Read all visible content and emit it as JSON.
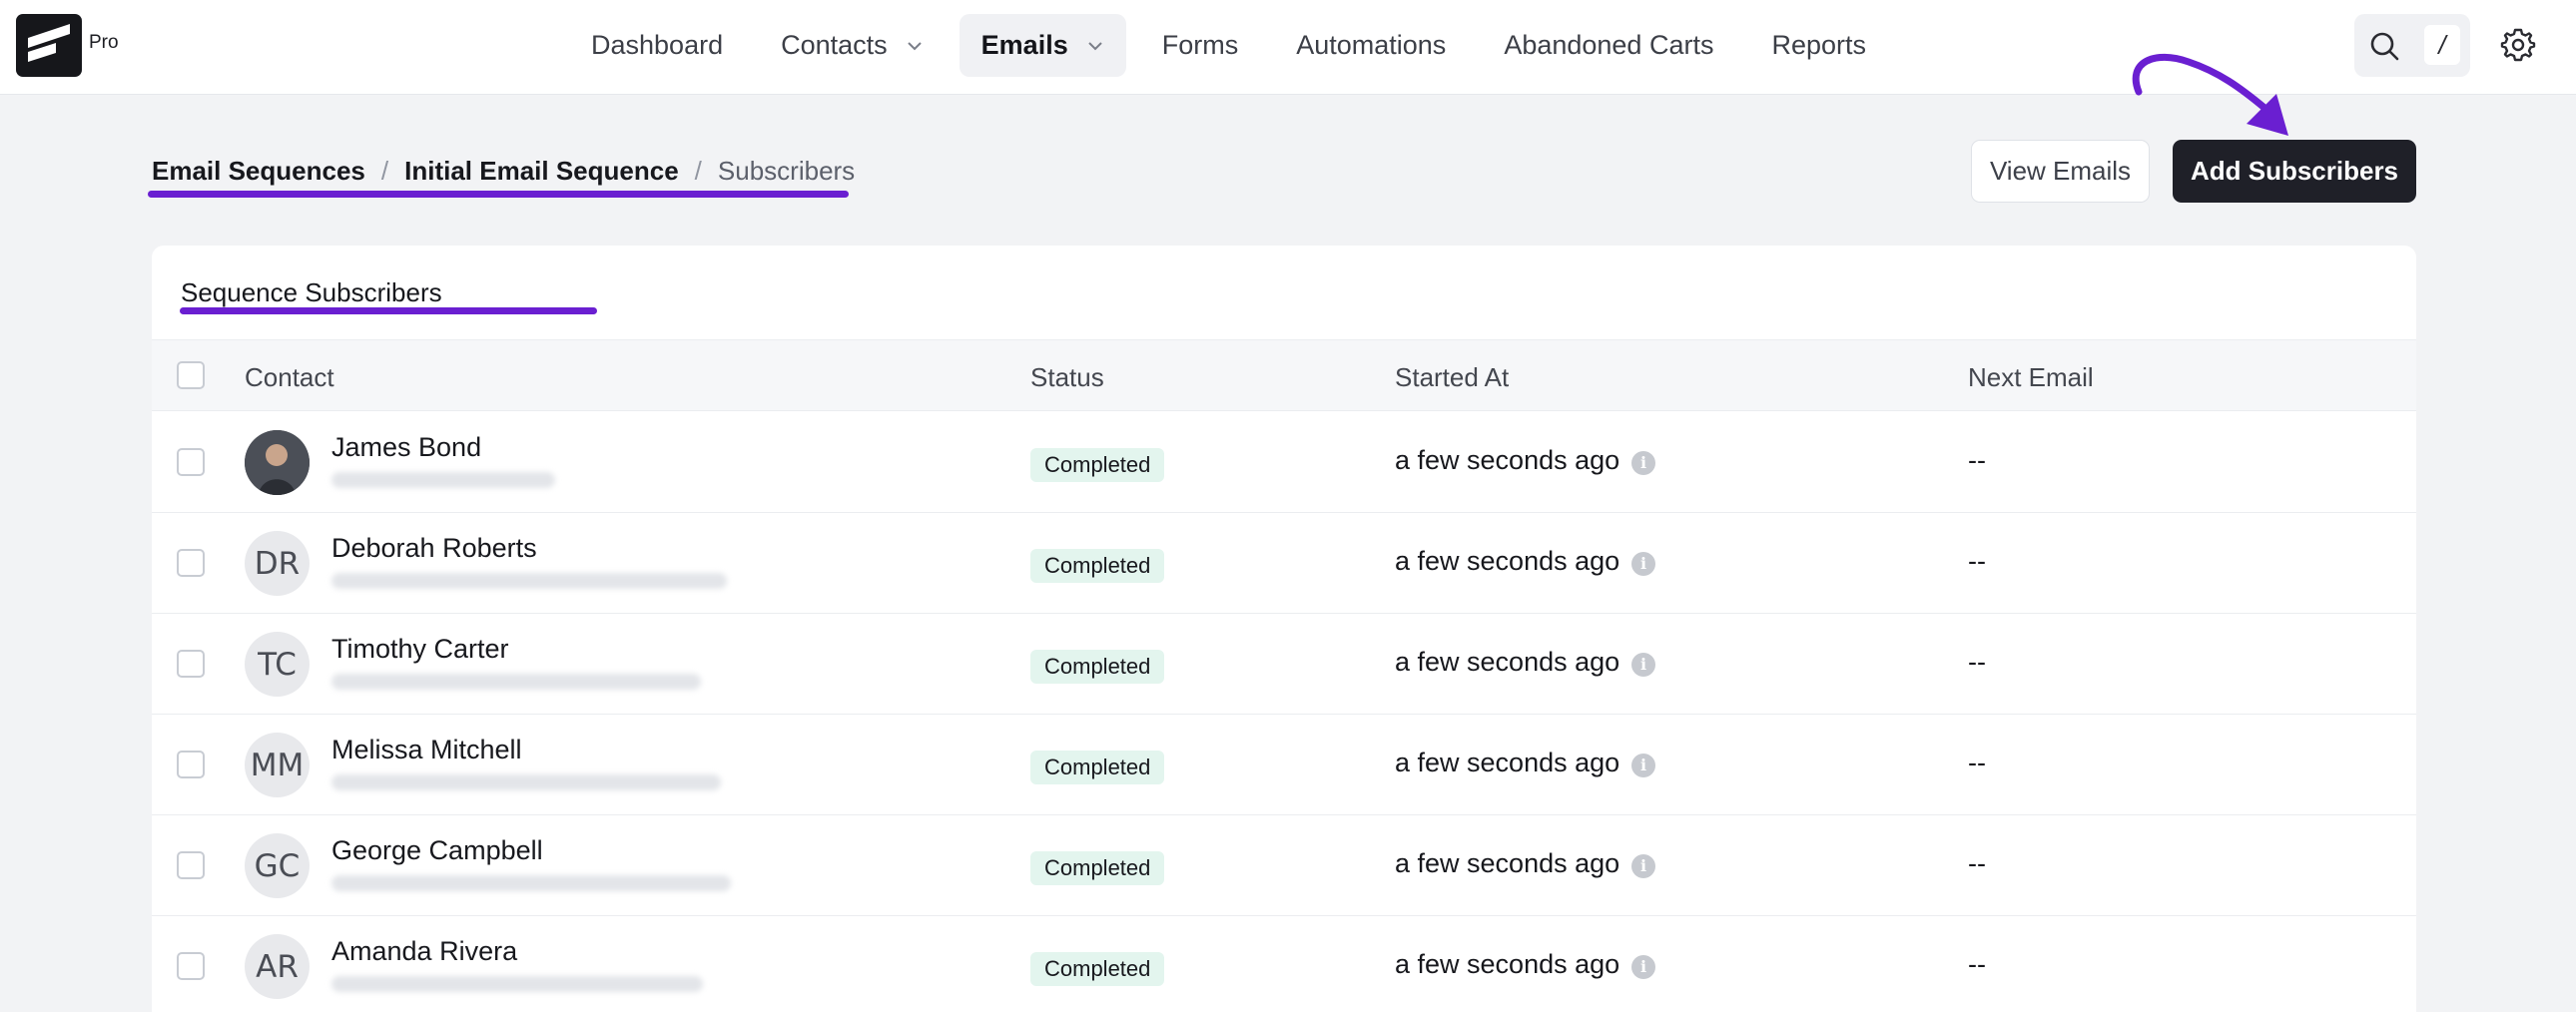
{
  "app": {
    "badge": "Pro"
  },
  "nav": {
    "items": [
      {
        "label": "Dashboard",
        "has_dropdown": false,
        "active": false
      },
      {
        "label": "Contacts",
        "has_dropdown": true,
        "active": false
      },
      {
        "label": "Emails",
        "has_dropdown": true,
        "active": true
      },
      {
        "label": "Forms",
        "has_dropdown": false,
        "active": false
      },
      {
        "label": "Automations",
        "has_dropdown": false,
        "active": false
      },
      {
        "label": "Abandoned Carts",
        "has_dropdown": false,
        "active": false
      },
      {
        "label": "Reports",
        "has_dropdown": false,
        "active": false
      }
    ],
    "search_shortcut": "/",
    "search_icon": "search-icon",
    "settings_icon": "gear-icon"
  },
  "breadcrumb": {
    "items": [
      "Email Sequences",
      "Initial Email Sequence",
      "Subscribers"
    ],
    "separator": "/"
  },
  "actions": {
    "view_emails": "View Emails",
    "add_subscribers": "Add Subscribers"
  },
  "card": {
    "title": "Sequence Subscribers"
  },
  "table": {
    "columns": [
      "Contact",
      "Status",
      "Started At",
      "Next Email"
    ],
    "rows": [
      {
        "name": "James Bond",
        "initials": "",
        "avatar_type": "photo",
        "status": "Completed",
        "started_at": "a few seconds ago",
        "next_email": "--"
      },
      {
        "name": "Deborah Roberts",
        "initials": "DR",
        "avatar_type": "initials",
        "status": "Completed",
        "started_at": "a few seconds ago",
        "next_email": "--"
      },
      {
        "name": "Timothy Carter",
        "initials": "TC",
        "avatar_type": "initials",
        "status": "Completed",
        "started_at": "a few seconds ago",
        "next_email": "--"
      },
      {
        "name": "Melissa Mitchell",
        "initials": "MM",
        "avatar_type": "initials",
        "status": "Completed",
        "started_at": "a few seconds ago",
        "next_email": "--"
      },
      {
        "name": "George Campbell",
        "initials": "GC",
        "avatar_type": "initials",
        "status": "Completed",
        "started_at": "a few seconds ago",
        "next_email": "--"
      },
      {
        "name": "Amanda Rivera",
        "initials": "AR",
        "avatar_type": "initials",
        "status": "Completed",
        "started_at": "a few seconds ago",
        "next_email": "--"
      }
    ]
  },
  "colors": {
    "accent": "#6a1fd1",
    "primary_button": "#1f2028",
    "status_completed_bg": "#e3f5ee"
  }
}
